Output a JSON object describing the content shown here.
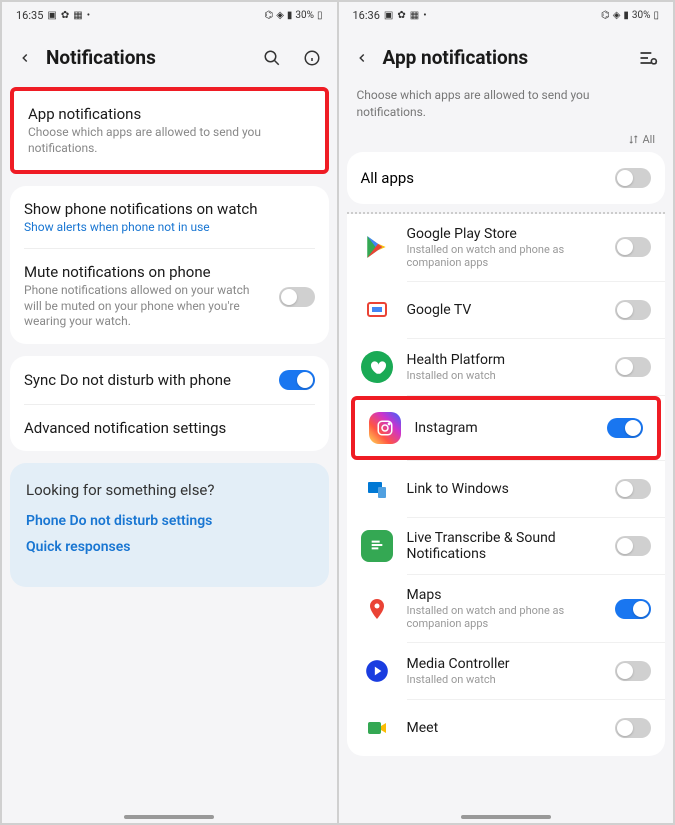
{
  "screen1": {
    "status": {
      "time": "16:35",
      "battery": "30%"
    },
    "header": {
      "title": "Notifications"
    },
    "app_notif": {
      "title": "App notifications",
      "sub": "Choose which apps are allowed to send you notifications."
    },
    "show_watch": {
      "title": "Show phone notifications on watch",
      "link": "Show alerts when phone not in use"
    },
    "mute": {
      "title": "Mute notifications on phone",
      "sub": "Phone notifications allowed on your watch will be muted on your phone when you're wearing your watch."
    },
    "sync": {
      "title": "Sync Do not disturb with phone"
    },
    "advanced": {
      "title": "Advanced notification settings"
    },
    "suggestions": {
      "title": "Looking for something else?",
      "link1": "Phone Do not disturb settings",
      "link2": "Quick responses"
    }
  },
  "screen2": {
    "status": {
      "time": "16:36",
      "battery": "30%"
    },
    "header": {
      "title": "App notifications"
    },
    "sub": "Choose which apps are allowed to send you notifications.",
    "sort_label": "All",
    "all_apps": "All apps",
    "apps": [
      {
        "name": "Google Play Store",
        "sub": "Installed on watch and phone as companion apps",
        "on": false
      },
      {
        "name": "Google TV",
        "sub": "",
        "on": false
      },
      {
        "name": "Health Platform",
        "sub": "Installed on watch",
        "on": false
      },
      {
        "name": "Instagram",
        "sub": "",
        "on": true
      },
      {
        "name": "Link to Windows",
        "sub": "",
        "on": false
      },
      {
        "name": "Live Transcribe & Sound Notifications",
        "sub": "",
        "on": false
      },
      {
        "name": "Maps",
        "sub": "Installed on watch and phone as companion apps",
        "on": true
      },
      {
        "name": "Media Controller",
        "sub": "Installed on watch",
        "on": false
      },
      {
        "name": "Meet",
        "sub": "",
        "on": false
      }
    ]
  }
}
